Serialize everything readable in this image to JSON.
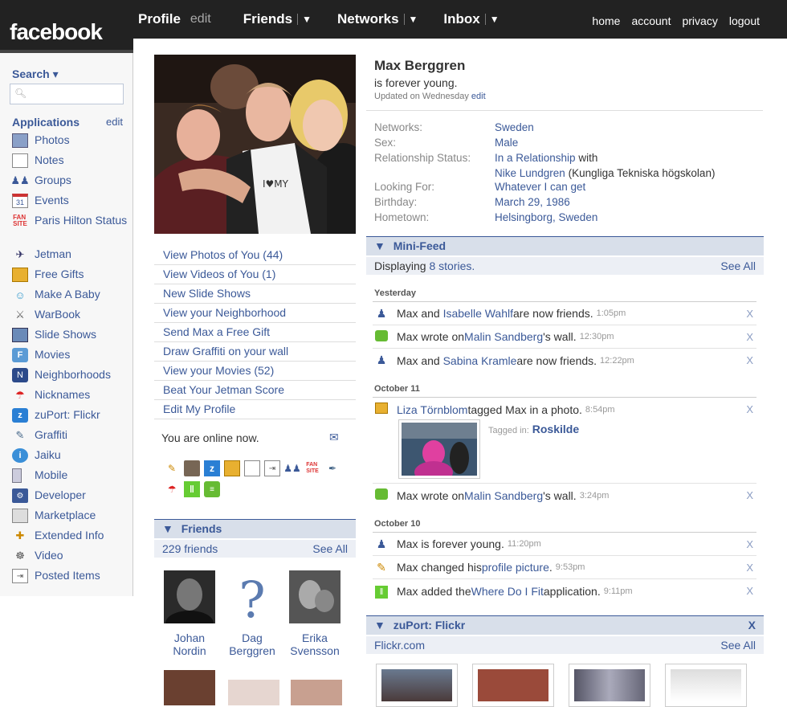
{
  "brand": "facebook",
  "nav": {
    "profile": "Profile",
    "edit": "edit",
    "friends": "Friends",
    "networks": "Networks",
    "inbox": "Inbox",
    "arrow": "▼",
    "right": [
      "home",
      "account",
      "privacy",
      "logout"
    ]
  },
  "sidebar": {
    "search_label": "Search ▾",
    "applications": "Applications",
    "apps_edit": "edit",
    "apps": [
      {
        "label": "Photos",
        "icon": "photos-icon"
      },
      {
        "label": "Notes",
        "icon": "notes-icon"
      },
      {
        "label": "Groups",
        "icon": "groups-icon"
      },
      {
        "label": "Events",
        "icon": "events-icon"
      },
      {
        "label": "Paris Hilton Status",
        "icon": "fan-icon"
      },
      {
        "label": "Jetman",
        "icon": "jetman-icon"
      },
      {
        "label": "Free Gifts",
        "icon": "gift-icon"
      },
      {
        "label": "Make A Baby",
        "icon": "baby-icon"
      },
      {
        "label": "WarBook",
        "icon": "sword-icon"
      },
      {
        "label": "Slide Shows",
        "icon": "slides-icon"
      },
      {
        "label": "Movies",
        "icon": "movies-icon"
      },
      {
        "label": "Neighborhoods",
        "icon": "neighborhood-icon"
      },
      {
        "label": "Nicknames",
        "icon": "umbrella-icon"
      },
      {
        "label": "zuPort: Flickr",
        "icon": "flickr-icon"
      },
      {
        "label": "Graffiti",
        "icon": "brush-icon"
      },
      {
        "label": "Jaiku",
        "icon": "jaiku-icon"
      },
      {
        "label": "Mobile",
        "icon": "mobile-icon"
      },
      {
        "label": "Developer",
        "icon": "developer-icon"
      },
      {
        "label": "Marketplace",
        "icon": "marketplace-icon"
      },
      {
        "label": "Extended Info",
        "icon": "info-icon"
      },
      {
        "label": "Video",
        "icon": "video-icon"
      },
      {
        "label": "Posted Items",
        "icon": "posted-icon"
      }
    ]
  },
  "actions": [
    "View Photos of You (44)",
    "View Videos of You (1)",
    "New Slide Shows",
    "View your Neighborhood",
    "Send Max a Free Gift",
    "Draw Graffiti on your wall",
    "View your Movies (52)",
    "Beat Your Jetman Score",
    "Edit My Profile"
  ],
  "online_text": "You are online now.",
  "friends_box": {
    "title": "Friends",
    "count": "229 friends",
    "see_all": "See All",
    "people": [
      {
        "first": "Johan",
        "last": "Nordin"
      },
      {
        "first": "Dag",
        "last": "Berggren"
      },
      {
        "first": "Erika",
        "last": "Svensson"
      }
    ]
  },
  "profile": {
    "name": "Max Berggren",
    "status": "is forever young.",
    "updated": "Updated on Wednesday",
    "updated_edit": "edit"
  },
  "info": {
    "networks_k": "Networks:",
    "networks_v": "Sweden",
    "sex_k": "Sex:",
    "sex_v": "Male",
    "rel_k": "Relationship Status:",
    "rel_v": "In a Relationship",
    "rel_with": "with",
    "rel_partner": "Nike Lundgren",
    "rel_school": "(Kungliga Tekniska högskolan)",
    "looking_k": "Looking For:",
    "looking_v": "Whatever I can get",
    "birthday_k": "Birthday:",
    "birthday_v": "March 29, 1986",
    "hometown_k": "Hometown:",
    "hometown_v": "Helsingborg, Sweden"
  },
  "minifeed": {
    "title": "Mini-Feed",
    "displaying": "Displaying",
    "stories": "8 stories.",
    "see_all": "See All",
    "days": [
      "Yesterday",
      "October 11",
      "October 10"
    ],
    "x": "X",
    "items": [
      {
        "a": "Max and ",
        "l": "Isabelle Wahlf",
        "b": " are now friends.",
        "t": "1:05pm"
      },
      {
        "a": "Max wrote on ",
        "l": "Malin Sandberg",
        "b": "'s wall.",
        "t": "12:30pm"
      },
      {
        "a": "Max and ",
        "l": "Sabina Kramle",
        "b": " are now friends.",
        "t": "12:22pm"
      },
      {
        "a": "",
        "l": "Liza Törnblom",
        "b": " tagged Max in a photo.",
        "t": "8:54pm"
      },
      {
        "a": "Max wrote on ",
        "l": "Malin Sandberg",
        "b": "'s wall.",
        "t": "3:24pm"
      },
      {
        "a": "Max is forever young.",
        "l": "",
        "b": "",
        "t": "11:20pm"
      },
      {
        "a": "Max changed his ",
        "l": "profile picture",
        "b": ".",
        "t": "9:53pm"
      },
      {
        "a": "Max added the ",
        "l": "Where Do I Fit",
        "b": " application.",
        "t": "9:11pm"
      }
    ],
    "tagged_in": "Tagged in:",
    "tagged_place": "Roskilde"
  },
  "flickr": {
    "title": "zuPort: Flickr",
    "close": "X",
    "source": "Flickr.com",
    "see_all": "See All"
  }
}
